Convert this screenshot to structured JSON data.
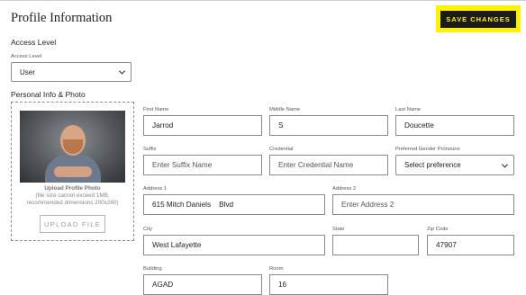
{
  "header": {
    "title": "Profile Information",
    "save_label": "SAVE CHANGES"
  },
  "access": {
    "section_title": "Access Level",
    "label": "Access Level",
    "value": "User"
  },
  "personal": {
    "section_title": "Personal Info & Photo"
  },
  "photo": {
    "upload_title": "Upload Profile Photo",
    "note_line1": "(file size cannot exceed 1MB,",
    "note_line2": "recommended dimensions 200x280)",
    "upload_button": "UPLOAD FILE"
  },
  "form": {
    "first_name": {
      "label": "First Name",
      "value": "Jarrod"
    },
    "middle_name": {
      "label": "Middle Name",
      "value": "S"
    },
    "last_name": {
      "label": "Last Name",
      "value": "Doucette"
    },
    "suffix": {
      "label": "Suffix",
      "placeholder": "Enter Suffix Name"
    },
    "credential": {
      "label": "Credential",
      "placeholder": "Enter Credential Name"
    },
    "pronouns": {
      "label": "Preferred Gender Pronouns",
      "value": "Select preference"
    },
    "address1": {
      "label": "Address 1",
      "value": "615 Mitch Daniels    Blvd"
    },
    "address2": {
      "label": "Address 2",
      "placeholder": "Enter Address 2"
    },
    "city": {
      "label": "City",
      "value": "West Lafayette"
    },
    "state": {
      "label": "State",
      "value": ""
    },
    "zip": {
      "label": "Zip Code",
      "value": "47907"
    },
    "building": {
      "label": "Building",
      "value": "AGAD"
    },
    "room": {
      "label": "Room",
      "value": "16"
    }
  },
  "colors": {
    "save_highlight": "#fff200",
    "save_bg": "#1b1b1b",
    "border": "#8a8a8a"
  }
}
